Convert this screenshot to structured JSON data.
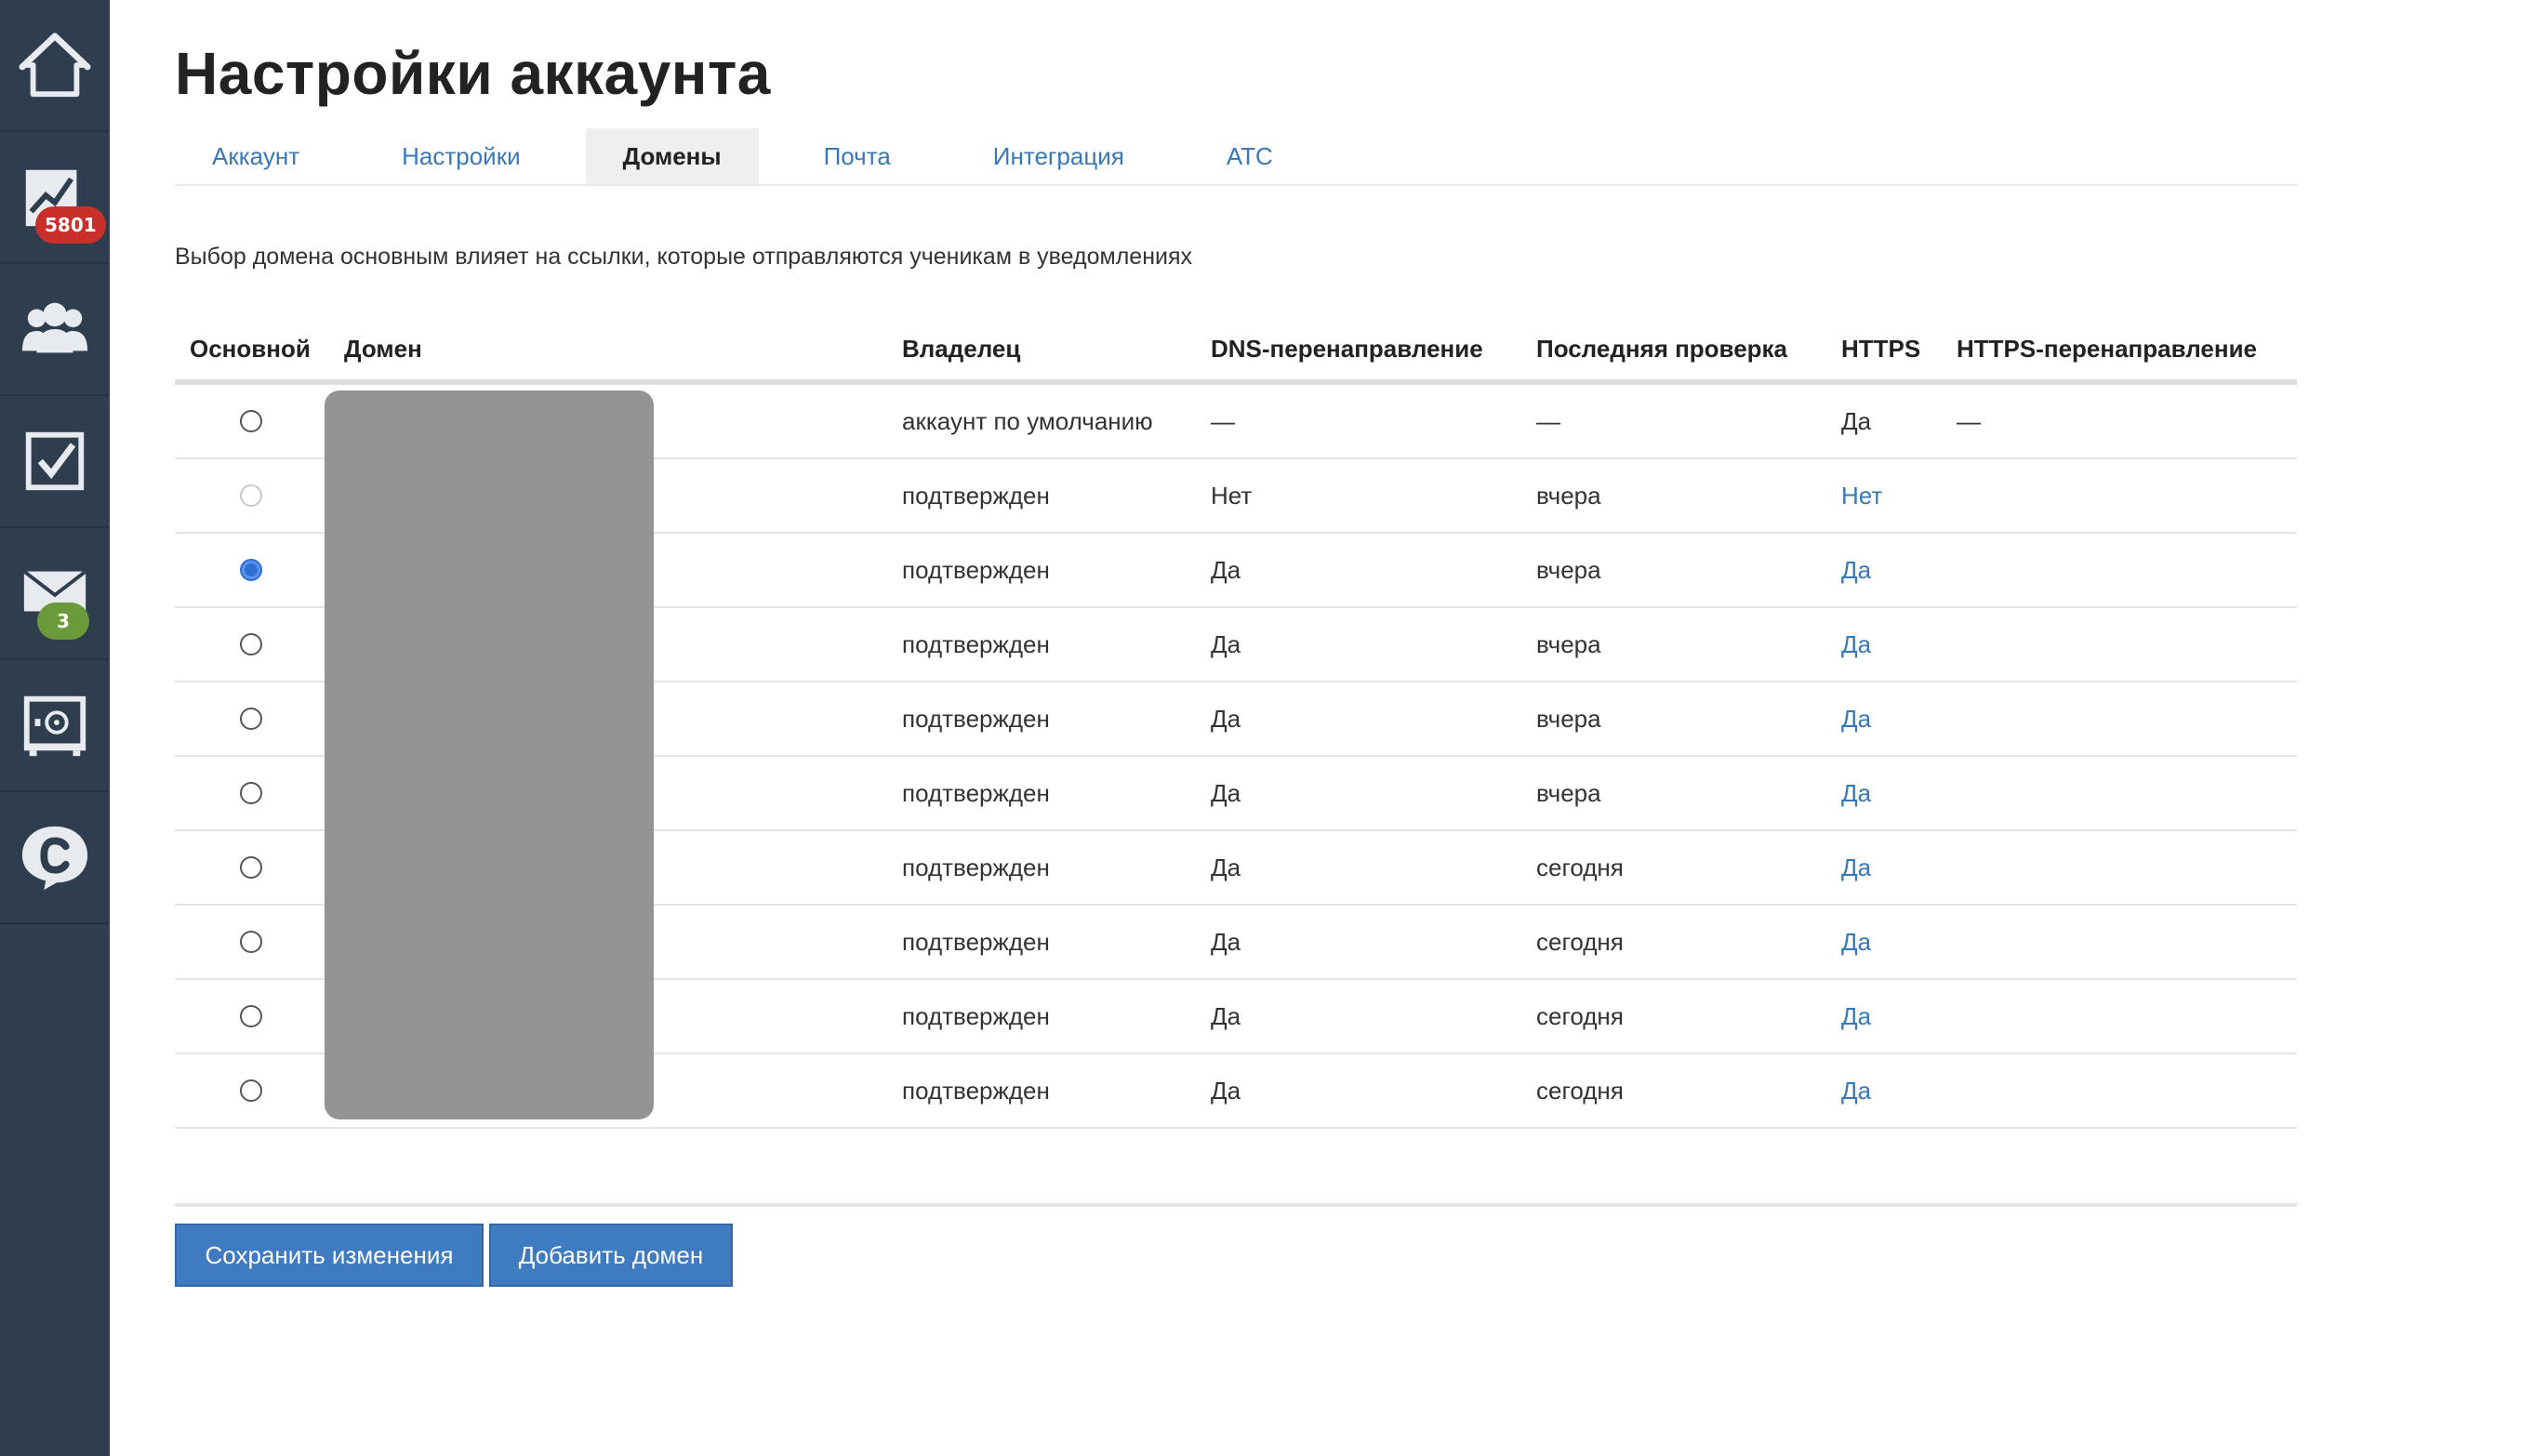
{
  "sidebar": {
    "items": [
      {
        "icon": "home-icon"
      },
      {
        "icon": "chart-icon",
        "badge": "5801",
        "badge_color": "#c9302c"
      },
      {
        "icon": "users-icon"
      },
      {
        "icon": "checkbox-icon"
      },
      {
        "icon": "mail-icon",
        "badge": "3",
        "badge_color": "#6a9a3a"
      },
      {
        "icon": "safe-icon"
      },
      {
        "icon": "chat-icon"
      }
    ]
  },
  "page": {
    "title": "Настройки аккаунта",
    "tabs": [
      {
        "label": "Аккаунт",
        "active": false
      },
      {
        "label": "Настройки",
        "active": false
      },
      {
        "label": "Домены",
        "active": true
      },
      {
        "label": "Почта",
        "active": false
      },
      {
        "label": "Интеграция",
        "active": false
      },
      {
        "label": "АТС",
        "active": false
      }
    ],
    "note": "Выбор домена основным влияет на ссылки, которые отправляются ученикам в уведомлениях"
  },
  "table": {
    "headers": {
      "primary": "Основной",
      "domain": "Домен",
      "owner": "Владелец",
      "dns": "DNS-перенаправление",
      "last_check": "Последняя проверка",
      "https": "HTTPS",
      "https_redirect": "HTTPS-перенаправление"
    },
    "rows": [
      {
        "radio": "unchecked",
        "owner": "аккаунт по умолчанию",
        "dns": "—",
        "last_check": "—",
        "https": "Да",
        "https_link": false,
        "https_redirect": "—"
      },
      {
        "radio": "disabled",
        "owner": "подтвержден",
        "dns": "Нет",
        "last_check": "вчера",
        "https": "Нет",
        "https_link": true,
        "https_redirect": ""
      },
      {
        "radio": "checked",
        "owner": "подтвержден",
        "dns": "Да",
        "last_check": "вчера",
        "https": "Да",
        "https_link": true,
        "https_redirect": ""
      },
      {
        "radio": "unchecked",
        "owner": "подтвержден",
        "dns": "Да",
        "last_check": "вчера",
        "https": "Да",
        "https_link": true,
        "https_redirect": ""
      },
      {
        "radio": "unchecked",
        "owner": "подтвержден",
        "dns": "Да",
        "last_check": "вчера",
        "https": "Да",
        "https_link": true,
        "https_redirect": ""
      },
      {
        "radio": "unchecked",
        "owner": "подтвержден",
        "dns": "Да",
        "last_check": "вчера",
        "https": "Да",
        "https_link": true,
        "https_redirect": ""
      },
      {
        "radio": "unchecked",
        "owner": "подтвержден",
        "dns": "Да",
        "last_check": "сегодня",
        "https": "Да",
        "https_link": true,
        "https_redirect": ""
      },
      {
        "radio": "unchecked",
        "owner": "подтвержден",
        "dns": "Да",
        "last_check": "сегодня",
        "https": "Да",
        "https_link": true,
        "https_redirect": ""
      },
      {
        "radio": "unchecked",
        "owner": "подтвержден",
        "dns": "Да",
        "last_check": "сегодня",
        "https": "Да",
        "https_link": true,
        "https_redirect": ""
      },
      {
        "radio": "unchecked",
        "owner": "подтвержден",
        "dns": "Да",
        "last_check": "сегодня",
        "https": "Да",
        "https_link": true,
        "https_redirect": ""
      }
    ]
  },
  "buttons": {
    "save": "Сохранить изменения",
    "add": "Добавить домен"
  }
}
